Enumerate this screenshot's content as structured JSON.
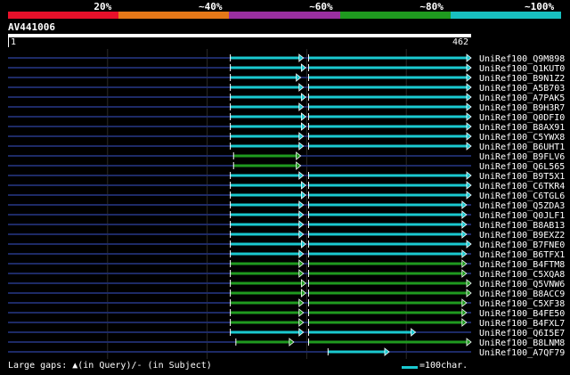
{
  "legend": {
    "labels": [
      "20%",
      "~40%",
      "~60%",
      "~80%",
      "~100%"
    ],
    "colors": [
      "#e8102a",
      "#e67818",
      "#9a2fa0",
      "#1f9a1f",
      "#18c0c0"
    ]
  },
  "query": {
    "title": "AV441006",
    "start": "1",
    "end": "462"
  },
  "colors": {
    "cyan": "#1ac9d0",
    "green": "#1f9a1f",
    "dim": "#1d2a66",
    "grid": "#2a2a2a"
  },
  "hits": [
    {
      "name": "UniRef100_Q9M898",
      "color": "cyan",
      "segments": [
        [
          0.48,
          0.638
        ],
        [
          0.649,
          1.0
        ]
      ]
    },
    {
      "name": "UniRef100_Q1KUT0",
      "color": "cyan",
      "segments": [
        [
          0.48,
          0.643
        ],
        [
          0.649,
          1.0
        ]
      ]
    },
    {
      "name": "UniRef100_B9N1Z2",
      "color": "cyan",
      "segments": [
        [
          0.48,
          0.632
        ],
        [
          0.649,
          1.0
        ]
      ]
    },
    {
      "name": "UniRef100_A5B703",
      "color": "cyan",
      "segments": [
        [
          0.48,
          0.638
        ],
        [
          0.649,
          1.0
        ]
      ]
    },
    {
      "name": "UniRef100_A7PAK5",
      "color": "cyan",
      "segments": [
        [
          0.48,
          0.643
        ],
        [
          0.649,
          1.0
        ]
      ]
    },
    {
      "name": "UniRef100_B9H3R7",
      "color": "cyan",
      "segments": [
        [
          0.48,
          0.638
        ],
        [
          0.649,
          1.0
        ]
      ]
    },
    {
      "name": "UniRef100_Q0DFI0",
      "color": "cyan",
      "segments": [
        [
          0.48,
          0.643
        ],
        [
          0.649,
          1.0
        ]
      ]
    },
    {
      "name": "UniRef100_B8AX91",
      "color": "cyan",
      "segments": [
        [
          0.48,
          0.643
        ],
        [
          0.649,
          1.0
        ]
      ]
    },
    {
      "name": "UniRef100_C5YWX8",
      "color": "cyan",
      "segments": [
        [
          0.48,
          0.638
        ],
        [
          0.649,
          1.0
        ]
      ]
    },
    {
      "name": "UniRef100_B6UHT1",
      "color": "cyan",
      "segments": [
        [
          0.48,
          0.638
        ],
        [
          0.649,
          1.0
        ]
      ]
    },
    {
      "name": "UniRef100_B9FLV6",
      "color": "green",
      "segments": [
        [
          0.487,
          0.632
        ]
      ]
    },
    {
      "name": "UniRef100_Q6L565",
      "color": "green",
      "segments": [
        [
          0.487,
          0.632
        ]
      ]
    },
    {
      "name": "UniRef100_B9T5X1",
      "color": "cyan",
      "segments": [
        [
          0.48,
          0.638
        ],
        [
          0.649,
          1.0
        ]
      ]
    },
    {
      "name": "UniRef100_C6TKR4",
      "color": "cyan",
      "segments": [
        [
          0.48,
          0.643
        ],
        [
          0.649,
          1.0
        ]
      ]
    },
    {
      "name": "UniRef100_C6TGL6",
      "color": "cyan",
      "segments": [
        [
          0.48,
          0.643
        ],
        [
          0.649,
          1.0
        ]
      ]
    },
    {
      "name": "UniRef100_Q5ZDA3",
      "color": "cyan",
      "segments": [
        [
          0.48,
          0.638
        ],
        [
          0.649,
          0.99
        ]
      ]
    },
    {
      "name": "UniRef100_Q0JLF1",
      "color": "cyan",
      "segments": [
        [
          0.48,
          0.638
        ],
        [
          0.649,
          0.99
        ]
      ]
    },
    {
      "name": "UniRef100_B8AB13",
      "color": "cyan",
      "segments": [
        [
          0.48,
          0.638
        ],
        [
          0.649,
          0.99
        ]
      ]
    },
    {
      "name": "UniRef100_B9EXZ2",
      "color": "cyan",
      "segments": [
        [
          0.48,
          0.638
        ],
        [
          0.649,
          0.99
        ]
      ]
    },
    {
      "name": "UniRef100_B7FNE0",
      "color": "cyan",
      "segments": [
        [
          0.48,
          0.643
        ],
        [
          0.649,
          1.0
        ]
      ]
    },
    {
      "name": "UniRef100_B6TFX1",
      "color": "cyan",
      "segments": [
        [
          0.48,
          0.638
        ],
        [
          0.649,
          0.99
        ]
      ]
    },
    {
      "name": "UniRef100_B4FTM8",
      "color": "green",
      "segments": [
        [
          0.48,
          0.638
        ],
        [
          0.649,
          0.99
        ]
      ]
    },
    {
      "name": "UniRef100_C5XQA8",
      "color": "green",
      "segments": [
        [
          0.48,
          0.638
        ],
        [
          0.649,
          0.99
        ]
      ]
    },
    {
      "name": "UniRef100_Q5VNW6",
      "color": "green",
      "segments": [
        [
          0.48,
          0.643
        ],
        [
          0.649,
          1.0
        ]
      ]
    },
    {
      "name": "UniRef100_B8ACC9",
      "color": "green",
      "segments": [
        [
          0.48,
          0.643
        ],
        [
          0.649,
          1.0
        ]
      ]
    },
    {
      "name": "UniRef100_C5XF38",
      "color": "green",
      "segments": [
        [
          0.48,
          0.638
        ],
        [
          0.649,
          0.99
        ]
      ]
    },
    {
      "name": "UniRef100_B4FE50",
      "color": "green",
      "segments": [
        [
          0.48,
          0.638
        ],
        [
          0.649,
          0.99
        ]
      ]
    },
    {
      "name": "UniRef100_B4FXL7",
      "color": "green",
      "segments": [
        [
          0.48,
          0.638
        ],
        [
          0.649,
          0.99
        ]
      ]
    },
    {
      "name": "UniRef100_Q6I5E7",
      "color": "cyan",
      "segments": [
        [
          0.48,
          0.638
        ],
        [
          0.649,
          0.88
        ]
      ]
    },
    {
      "name": "UniRef100_B8LNM8",
      "color": "green",
      "segments": [
        [
          0.492,
          0.617
        ],
        [
          0.649,
          1.0
        ]
      ]
    },
    {
      "name": "UniRef100_A7QF79",
      "color": "cyan",
      "segments": [
        [
          0.691,
          0.823
        ]
      ]
    }
  ],
  "footer": {
    "gap_legend": "Large gaps: ▲(in Query)/- (in Subject)",
    "scale_label": "=100char."
  }
}
